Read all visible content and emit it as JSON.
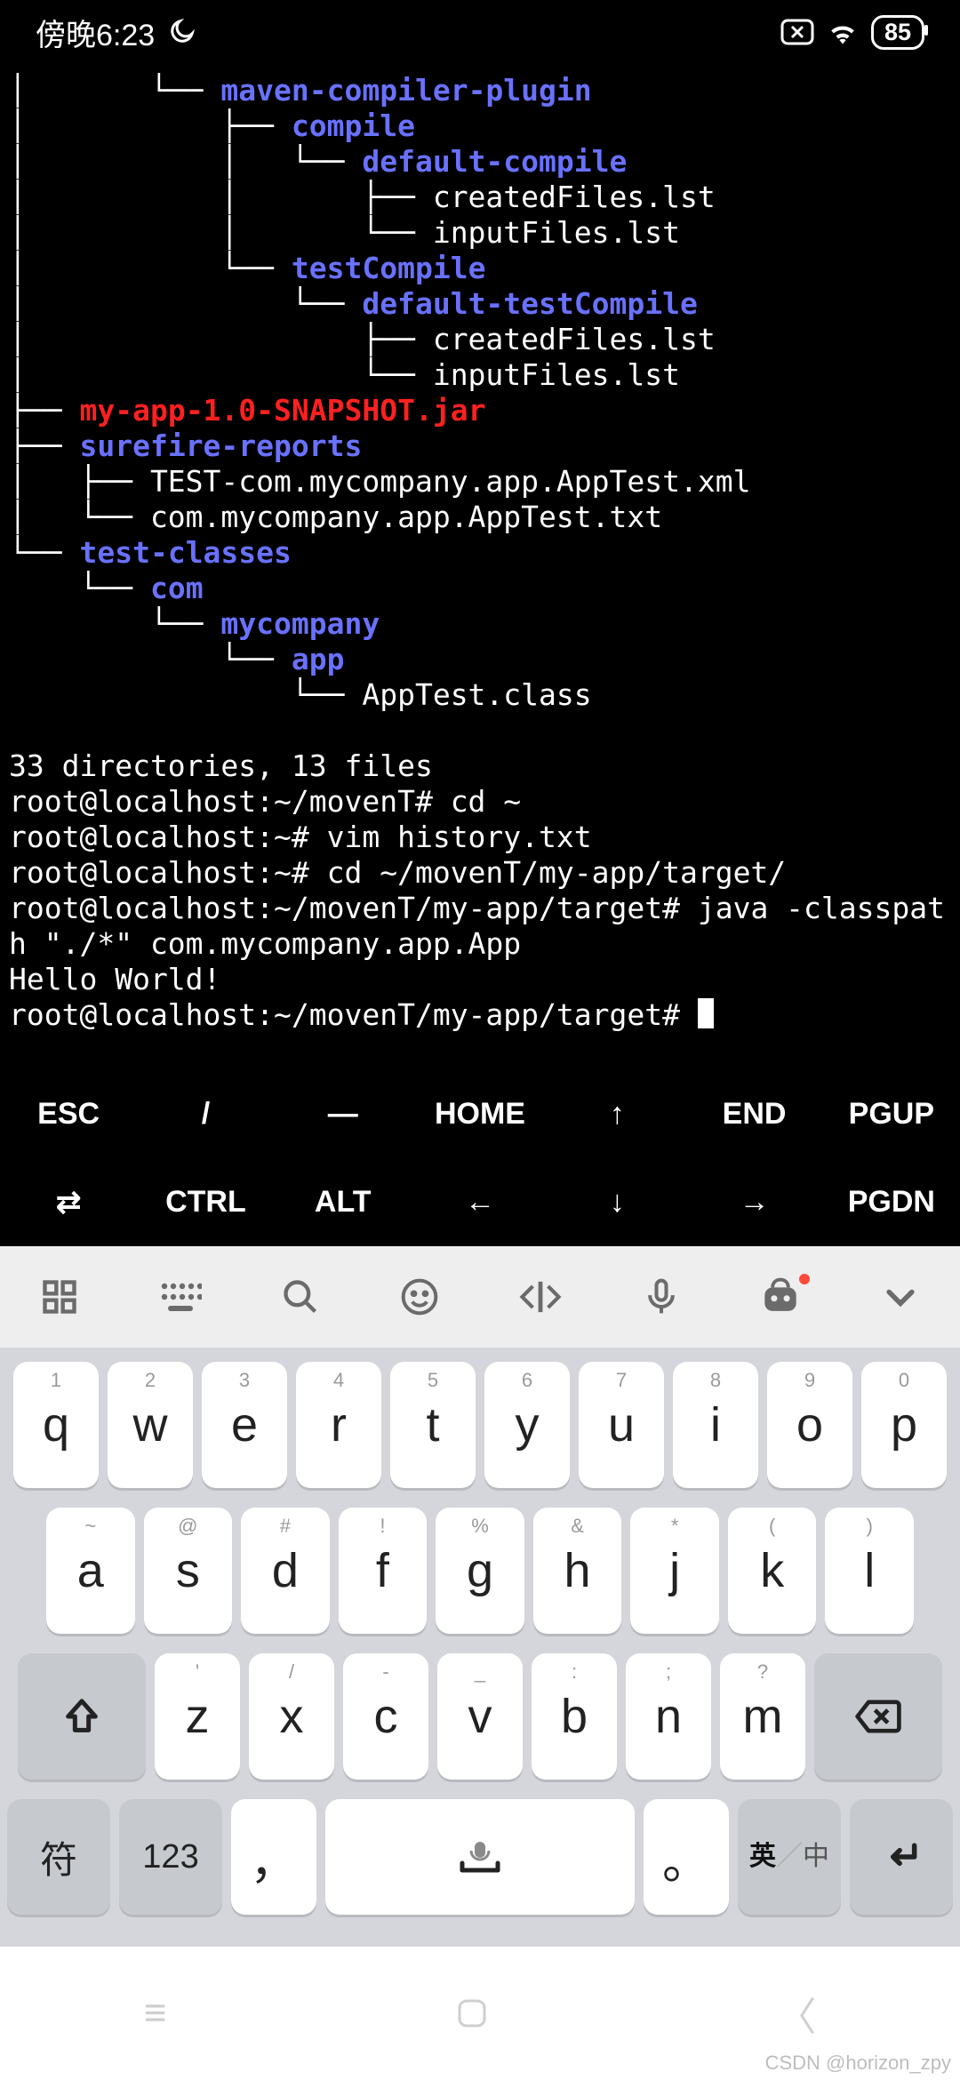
{
  "status": {
    "time": "傍晚6:23",
    "moon_icon": "moon-icon",
    "xbox_icon": "x-box",
    "wifi_icon": "wifi",
    "battery": "85"
  },
  "tree": [
    {
      "indent": "│       └── ",
      "text": "maven-compiler-plugin",
      "cls": "blue"
    },
    {
      "indent": "│           ├── ",
      "text": "compile",
      "cls": "blue"
    },
    {
      "indent": "│           │   └── ",
      "text": "default-compile",
      "cls": "blue"
    },
    {
      "indent": "│           │       ├── createdFiles.lst",
      "text": "",
      "cls": ""
    },
    {
      "indent": "│           │       └── inputFiles.lst",
      "text": "",
      "cls": ""
    },
    {
      "indent": "│           └── ",
      "text": "testCompile",
      "cls": "blue"
    },
    {
      "indent": "│               └── ",
      "text": "default-testCompile",
      "cls": "blue"
    },
    {
      "indent": "│                   ├── createdFiles.lst",
      "text": "",
      "cls": ""
    },
    {
      "indent": "│                   └── inputFiles.lst",
      "text": "",
      "cls": ""
    },
    {
      "indent": "├── ",
      "text": "my-app-1.0-SNAPSHOT.jar",
      "cls": "red"
    },
    {
      "indent": "├── ",
      "text": "surefire-reports",
      "cls": "blue"
    },
    {
      "indent": "│   ├── TEST-com.mycompany.app.AppTest.xml",
      "text": "",
      "cls": ""
    },
    {
      "indent": "│   └── com.mycompany.app.AppTest.txt",
      "text": "",
      "cls": ""
    },
    {
      "indent": "└── ",
      "text": "test-classes",
      "cls": "blue"
    },
    {
      "indent": "    └── ",
      "text": "com",
      "cls": "blue"
    },
    {
      "indent": "        └── ",
      "text": "mycompany",
      "cls": "blue"
    },
    {
      "indent": "            └── ",
      "text": "app",
      "cls": "blue"
    },
    {
      "indent": "                └── AppTest.class",
      "text": "",
      "cls": ""
    }
  ],
  "summary": "33 directories, 13 files",
  "shell": [
    "root@localhost:~/movenT# cd ~",
    "root@localhost:~# vim history.txt",
    "root@localhost:~# cd ~/movenT/my-app/target/",
    "root@localhost:~/movenT/my-app/target# java -classpat",
    "h \"./*\" com.mycompany.app.App",
    "Hello World!",
    "root@localhost:~/movenT/my-app/target# "
  ],
  "extra": {
    "row1": [
      "ESC",
      "/",
      "—",
      "HOME",
      "↑",
      "END",
      "PGUP"
    ],
    "row2": [
      "⇄",
      "CTRL",
      "ALT",
      "←",
      "↓",
      "→",
      "PGDN"
    ]
  },
  "ime_icons": [
    "grid-icon",
    "keyboard-icon",
    "search-icon",
    "smile-icon",
    "code-icon",
    "mic-icon",
    "bot-icon",
    "chevron-down-icon"
  ],
  "keyboard": {
    "row1": [
      {
        "h": "1",
        "m": "q"
      },
      {
        "h": "2",
        "m": "w"
      },
      {
        "h": "3",
        "m": "e"
      },
      {
        "h": "4",
        "m": "r"
      },
      {
        "h": "5",
        "m": "t"
      },
      {
        "h": "6",
        "m": "y"
      },
      {
        "h": "7",
        "m": "u"
      },
      {
        "h": "8",
        "m": "i"
      },
      {
        "h": "9",
        "m": "o"
      },
      {
        "h": "0",
        "m": "p"
      }
    ],
    "row2": [
      {
        "h": "~",
        "m": "a"
      },
      {
        "h": "@",
        "m": "s"
      },
      {
        "h": "#",
        "m": "d"
      },
      {
        "h": "!",
        "m": "f"
      },
      {
        "h": "%",
        "m": "g"
      },
      {
        "h": "&",
        "m": "h"
      },
      {
        "h": "*",
        "m": "j"
      },
      {
        "h": "(",
        "m": "k"
      },
      {
        "h": ")",
        "m": "l"
      }
    ],
    "row3": [
      {
        "h": "'",
        "m": "z"
      },
      {
        "h": "/",
        "m": "x"
      },
      {
        "h": "-",
        "m": "c"
      },
      {
        "h": "_",
        "m": "v"
      },
      {
        "h": ":",
        "m": "b"
      },
      {
        "h": ";",
        "m": "n"
      },
      {
        "h": "?",
        "m": "m"
      }
    ],
    "shift": "⇧",
    "backspace": "⌫",
    "symbols": "符",
    "num": "123",
    "comma": "，",
    "period": "。",
    "lang_en": "英",
    "lang_zh": "中",
    "enter": "↵"
  },
  "watermark": "CSDN @horizon_zpy"
}
